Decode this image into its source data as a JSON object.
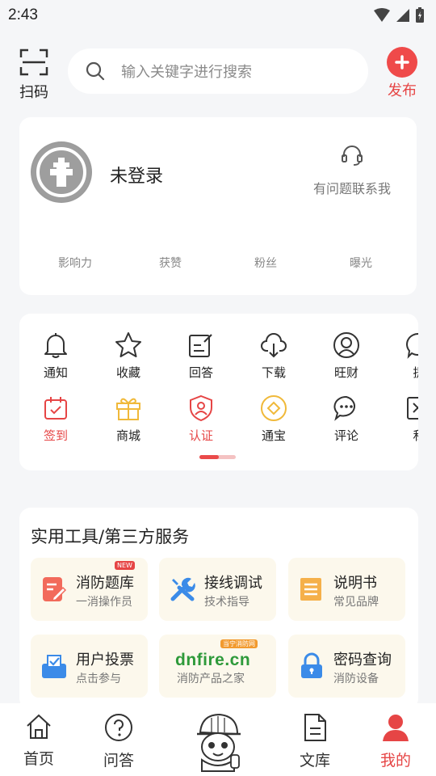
{
  "status": {
    "time": "2:43"
  },
  "header": {
    "scan_label": "扫码",
    "search_placeholder": "输入关键字进行搜索",
    "publish_label": "发布"
  },
  "profile": {
    "username": "未登录",
    "contact_label": "有问题联系我",
    "stats": [
      "影响力",
      "获赞",
      "粉丝",
      "曝光"
    ]
  },
  "features": {
    "row1": [
      {
        "label": "通知",
        "icon": "bell-icon"
      },
      {
        "label": "收藏",
        "icon": "star-icon"
      },
      {
        "label": "回答",
        "icon": "edit-icon"
      },
      {
        "label": "下载",
        "icon": "cloud-download-icon"
      },
      {
        "label": "旺财",
        "icon": "user-circle-icon"
      },
      {
        "label": "提",
        "icon": "chat-icon"
      }
    ],
    "row2": [
      {
        "label": "签到",
        "icon": "calendar-check-icon"
      },
      {
        "label": "商城",
        "icon": "gift-icon"
      },
      {
        "label": "认证",
        "icon": "shield-user-icon"
      },
      {
        "label": "通宝",
        "icon": "coin-icon"
      },
      {
        "label": "评论",
        "icon": "comment-icon"
      },
      {
        "label": "私",
        "icon": "message-icon"
      }
    ]
  },
  "tools": {
    "title": "实用工具/第三方服务",
    "items": [
      {
        "name": "消防题库",
        "sub": "一消操作员",
        "icon": "quiz-icon",
        "badge": "NEW"
      },
      {
        "name": "接线调试",
        "sub": "技术指导",
        "icon": "wrench-icon"
      },
      {
        "name": "说明书",
        "sub": "常见品牌",
        "icon": "document-icon"
      },
      {
        "name": "用户投票",
        "sub": "点击参与",
        "icon": "vote-icon"
      },
      {
        "name": "dnfire.cn",
        "sub": "消防产品之家",
        "icon": "dnfire-logo",
        "logo_tag": "当宁消防网"
      },
      {
        "name": "密码查询",
        "sub": "消防设备",
        "icon": "lock-icon"
      }
    ]
  },
  "nav": {
    "home": "首页",
    "qa": "问答",
    "library": "文库",
    "mine": "我的"
  },
  "colors": {
    "accent": "#e64545",
    "tool_bg": "#fcf8ec",
    "page_bg": "#f5f6f8"
  }
}
